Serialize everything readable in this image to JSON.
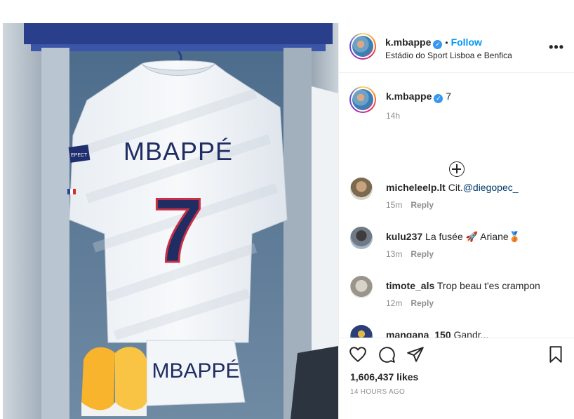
{
  "post": {
    "author": "k.mbappe",
    "follow_label": "Follow",
    "separator": "•",
    "location": "Estádio do Sport Lisboa e Benfica",
    "more_label": "•••",
    "caption": "7",
    "caption_time": "14h"
  },
  "photo": {
    "jersey_name": "MBAPPÉ",
    "jersey_number": "7",
    "shorts_name": "MBAPPÉ",
    "patch_text": "EPECT"
  },
  "comments": [
    {
      "user": "micheleelp.lt",
      "text_prefix": "Cit.",
      "mention": "@diegopec_",
      "text": "",
      "time": "15m",
      "reply": "Reply"
    },
    {
      "user": "kulu237",
      "text_prefix": "",
      "mention": "",
      "text": "La fusée 🚀 Ariane🥉",
      "time": "13m",
      "reply": "Reply"
    },
    {
      "user": "timote_als",
      "text_prefix": "",
      "mention": "",
      "text": "Trop beau t'es crampon",
      "time": "12m",
      "reply": "Reply"
    },
    {
      "user": "mangana_150",
      "text_prefix": "",
      "mention": "",
      "text": "Gandr...",
      "time": "",
      "reply": ""
    }
  ],
  "engagement": {
    "likes": "1,606,437 likes",
    "posted_ago": "14 HOURS AGO"
  },
  "icons": [
    "heart-icon",
    "comment-icon",
    "share-icon",
    "bookmark-icon",
    "verified-icon",
    "add-comment-icon"
  ],
  "colors": {
    "follow": "#0095f6",
    "verified": "#3897f0",
    "mention": "#00376b",
    "muted": "#8e8e8e"
  }
}
